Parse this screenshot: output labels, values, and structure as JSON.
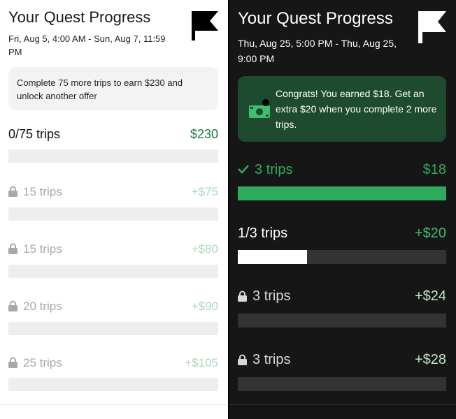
{
  "left_panel": {
    "title": "Your Quest Progress",
    "dates": "Fri, Aug 5, 4:00 AM - Sun, Aug 7, 11:59 PM",
    "info": "Complete 75 more trips to earn $230 and unlock another offer",
    "rows": [
      {
        "label": "0/75 trips",
        "amount": "$230",
        "state": "active",
        "progress": 0
      },
      {
        "label": "15 trips",
        "amount": "+$75",
        "state": "locked",
        "progress": 0
      },
      {
        "label": "15 trips",
        "amount": "+$80",
        "state": "locked",
        "progress": 0
      },
      {
        "label": "20 trips",
        "amount": "+$90",
        "state": "locked",
        "progress": 0
      },
      {
        "label": "25 trips",
        "amount": "+$105",
        "state": "locked",
        "progress": 0
      }
    ]
  },
  "right_panel": {
    "title": "Your Quest Progress",
    "dates": "Thu, Aug 25, 5:00 PM - Thu, Aug 25, 9:00 PM",
    "congrats": "Congrats! You earned $18. Get an extra $20 when you complete 2 more trips.",
    "rows": [
      {
        "label": "3 trips",
        "amount": "$18",
        "state": "done",
        "progress": 1
      },
      {
        "label": "1/3 trips",
        "amount": "+$20",
        "state": "active",
        "progress": 0.333
      },
      {
        "label": "3 trips",
        "amount": "+$24",
        "state": "locked",
        "progress": 0
      },
      {
        "label": "3 trips",
        "amount": "+$28",
        "state": "locked",
        "progress": 0
      }
    ]
  },
  "colors": {
    "green": "#1f7a45",
    "bright_green": "#2eaa5c",
    "congrats_bg": "#1e4a2f",
    "dark_bg": "#161616"
  },
  "icons": [
    "flag-icon",
    "lock-icon",
    "check-icon",
    "money-icon"
  ]
}
